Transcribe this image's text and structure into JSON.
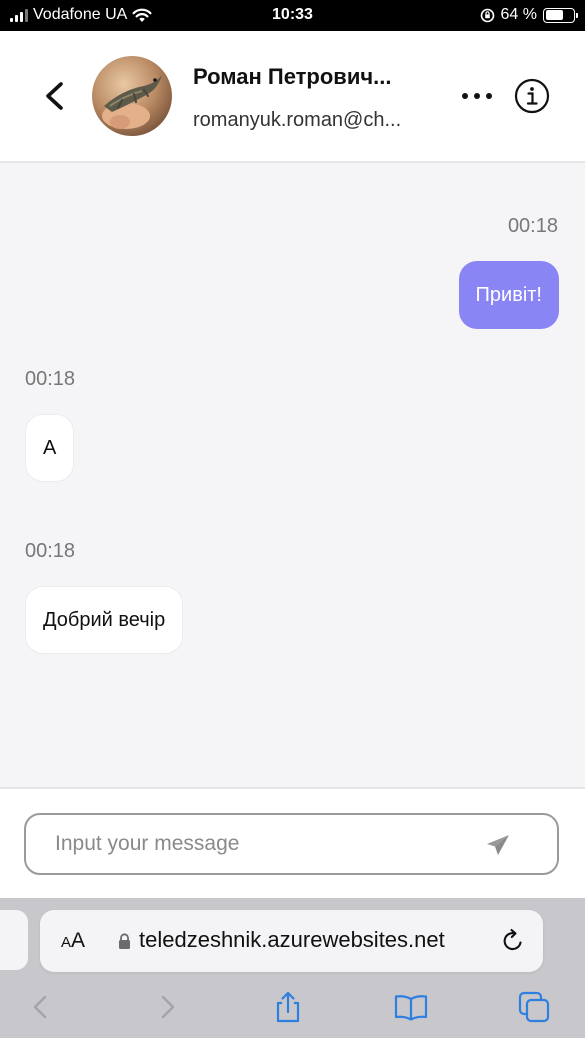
{
  "status_bar": {
    "carrier": "Vodafone UA",
    "time": "10:33",
    "battery": "64 %",
    "battery_level": 0.64
  },
  "header": {
    "contact_name": "Роман Петрович...",
    "contact_email": "romanyuk.roman@ch..."
  },
  "messages": [
    {
      "direction": "out",
      "time": "00:18",
      "text": "Привіт!"
    },
    {
      "direction": "in",
      "time": "00:18",
      "text": "А"
    },
    {
      "direction": "in",
      "time": "00:18",
      "text": "Добрий вечір"
    }
  ],
  "composer": {
    "placeholder": "Input your message",
    "value": ""
  },
  "browser": {
    "text_size_label_small": "A",
    "text_size_label_large": "A",
    "url": "teledzeshnik.azurewebsites.net"
  },
  "colors": {
    "outgoing_bubble": "#8a85f5",
    "chat_background": "#f5f5f8",
    "browser_accent": "#2f7fe0"
  }
}
